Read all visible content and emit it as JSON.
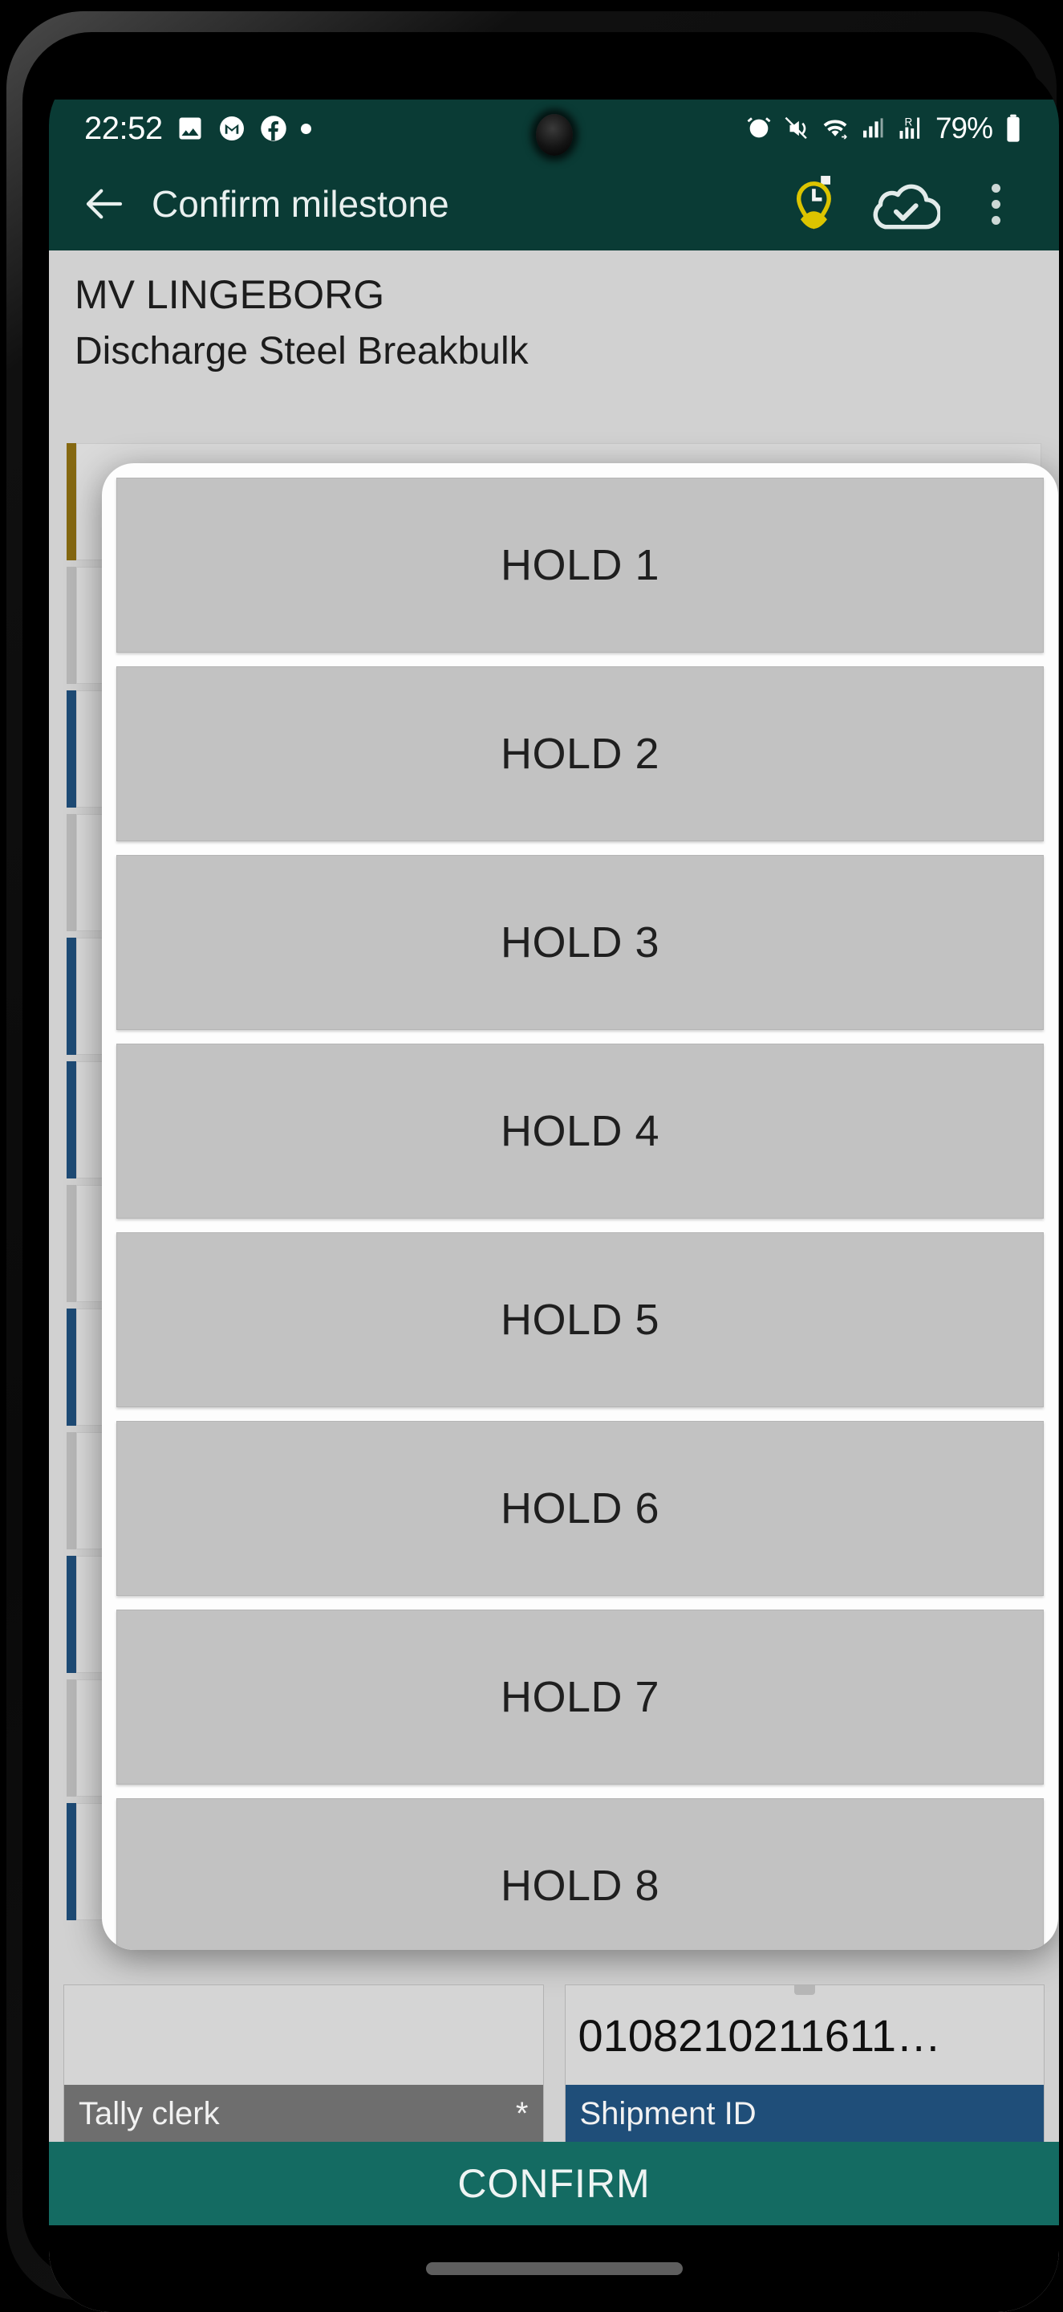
{
  "status_bar": {
    "time": "22:52",
    "left_icons": [
      "photo-icon",
      "gmail-icon",
      "facebook-icon",
      "dot-indicator-icon"
    ],
    "right_icons": [
      "alarm-icon",
      "vibrate-off-icon",
      "wifi-icon",
      "signal-icon",
      "roaming-signal-icon"
    ],
    "roaming_label": "R",
    "battery_percent": "79%"
  },
  "app_bar": {
    "back_label": "back-arrow-icon",
    "title": "Confirm milestone",
    "actions": [
      "location-time-pin-icon",
      "cloud-done-icon",
      "overflow-menu-icon"
    ]
  },
  "page": {
    "vessel": "MV LINGEBORG",
    "operation": "Discharge Steel Breakbulk"
  },
  "dialog": {
    "options": [
      {
        "label": "HOLD 1"
      },
      {
        "label": "HOLD 2"
      },
      {
        "label": "HOLD 3"
      },
      {
        "label": "HOLD 4"
      },
      {
        "label": "HOLD 5"
      },
      {
        "label": "HOLD 6"
      },
      {
        "label": "HOLD 7"
      },
      {
        "label": "HOLD 8"
      }
    ]
  },
  "fields": [
    {
      "value": "",
      "label": "Tally clerk",
      "required_mark": "*",
      "label_color": "#6e6e6e"
    },
    {
      "value": "0108210211611…",
      "label": "Shipment ID",
      "required_mark": "",
      "label_color": "#1f4e79"
    }
  ],
  "confirm_button": {
    "label": "CONFIRM",
    "color": "#146b62"
  },
  "nav_bar": {
    "gesture_pill": "gesture-pill"
  },
  "colors": {
    "app_bar": "#0a3b35",
    "accent_pin": "#d8c000",
    "confirm": "#146b62",
    "option_bg": "#c2c2c2",
    "page_bg": "#d8d8d8"
  }
}
